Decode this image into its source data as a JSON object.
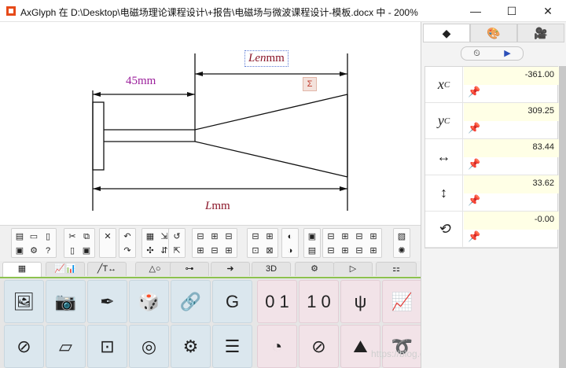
{
  "window": {
    "title": "AxGlyph 在 D:\\Desktop\\电磁场理论课程设计\\+报告\\电磁场与微波课程设计-模板.docx 中 - 200%",
    "minimize": "—",
    "maximize": "☐",
    "close": "✕"
  },
  "canvas": {
    "dim_45_value": "45",
    "dim_45_unit": "mm",
    "dim_len_var": "Len",
    "dim_len_unit": "mm",
    "dim_L_var": "L",
    "dim_L_unit": "mm",
    "badge": "Σ"
  },
  "toolbar": {
    "groups": [
      {
        "cols": 3,
        "icons": [
          "▤",
          "▭",
          "▯",
          "▣",
          "⚙",
          "?"
        ]
      },
      {
        "cols": 2,
        "icons": [
          "✂",
          "⧉",
          "▯",
          "▣"
        ]
      },
      {
        "cols": 1,
        "icons": [
          "✕"
        ]
      },
      {
        "cols": 1,
        "icons": [
          "↶",
          "↷"
        ]
      },
      {
        "cols": 2,
        "icons": [
          "▦",
          "⇲",
          "✣",
          "⇵"
        ]
      },
      {
        "cols": 1,
        "icons": [
          "↺",
          "⇱"
        ]
      },
      {
        "cols": 3,
        "icons": [
          "⊟",
          "⊞",
          "⊟",
          "⊞",
          "⊟",
          "⊞"
        ]
      },
      {
        "cols": 2,
        "icons": [
          "⊟",
          "⊞",
          "⊡",
          "⊠"
        ]
      },
      {
        "cols": 1,
        "icons": [
          "◐",
          "◑"
        ]
      },
      {
        "cols": 1,
        "icons": [
          "▣",
          "▤"
        ]
      },
      {
        "cols": 4,
        "icons": [
          "⊟",
          "⊞",
          "⊟",
          "⊞",
          "⊟",
          "⊞",
          "⊟",
          "⊞"
        ]
      },
      {
        "cols": 1,
        "icons": [
          "▧",
          "✺"
        ]
      }
    ]
  },
  "tabs": [
    "▦",
    "📈📊",
    "╱T↔",
    "△○",
    "⊶",
    "➜",
    "3D",
    "⚙",
    "▷",
    "⚏"
  ],
  "palette": {
    "left": [
      "🖼",
      "📷",
      "✒",
      "🎲",
      "🔗",
      "G",
      "⊘",
      "▱",
      "⊡",
      "◎",
      "⚙",
      "☰"
    ],
    "right": [
      "0 1",
      "1 0",
      "ψ",
      "📈",
      "◔",
      "⊘",
      "⛰",
      "➰"
    ]
  },
  "panel": {
    "tabs": [
      "◆",
      "🎨",
      "🎥"
    ],
    "modes": [
      "⏲",
      "▶"
    ],
    "props": [
      {
        "symbol": "x",
        "sub": "C",
        "value": "-361.00"
      },
      {
        "symbol": "y",
        "sub": "C",
        "value": "309.25"
      },
      {
        "symbol": "↔",
        "sub": "",
        "value": "83.44"
      },
      {
        "symbol": "↕",
        "sub": "",
        "value": "33.62"
      },
      {
        "symbol": "⟲",
        "sub": "",
        "value": "-0.00"
      }
    ],
    "pin": "📌"
  },
  "watermark": "https://blog.csdn.net/MamiyaHasaki"
}
